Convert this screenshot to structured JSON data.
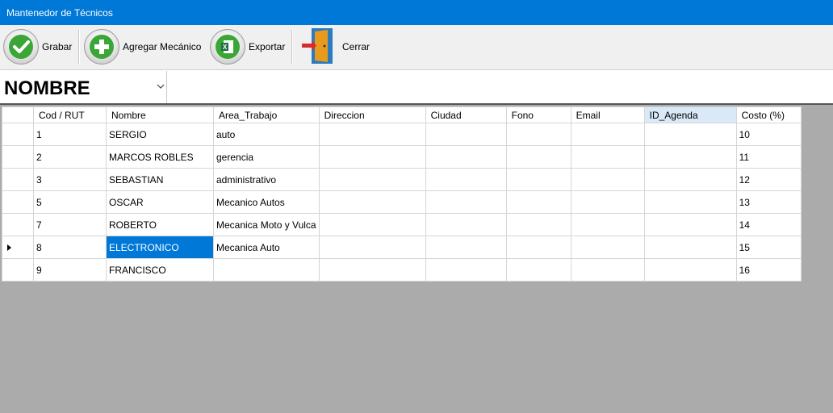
{
  "window": {
    "title": "Mantenedor de Técnicos"
  },
  "toolbar": {
    "grabar": "Grabar",
    "agregar": "Agregar Mecánico",
    "exportar": "Exportar",
    "cerrar": "Cerrar"
  },
  "filter": {
    "selected": "NOMBRE"
  },
  "grid": {
    "headers": [
      "Cod / RUT",
      "Nombre",
      "Area_Trabajo",
      "Direccion",
      "Ciudad",
      "Fono",
      "Email",
      "ID_Agenda",
      "Costo (%)"
    ],
    "rows": [
      [
        "1",
        "SERGIO",
        "auto",
        "",
        "",
        "",
        "",
        "",
        "10"
      ],
      [
        "2",
        "MARCOS ROBLES",
        "gerencia",
        "",
        "",
        "",
        "",
        "",
        "11"
      ],
      [
        "3",
        "SEBASTIAN",
        "administrativo",
        "",
        "",
        "",
        "",
        "",
        "12"
      ],
      [
        "5",
        "OSCAR",
        "Mecanico Autos",
        "",
        "",
        "",
        "",
        "",
        "13"
      ],
      [
        "7",
        "ROBERTO",
        "Mecanica Moto y Vulca",
        "",
        "",
        "",
        "",
        "",
        "14"
      ],
      [
        "8",
        "ELECTRONICO",
        "Mecanica Auto",
        "",
        "",
        "",
        "",
        "",
        "15"
      ],
      [
        "9",
        "FRANCISCO",
        "",
        "",
        "",
        "",
        "",
        "",
        "16"
      ]
    ]
  },
  "icons": {
    "grabar": "checkmark-icon",
    "agregar": "plus-icon",
    "exportar": "excel-icon",
    "cerrar": "door-exit-icon"
  },
  "colors": {
    "titlebar": "#0078d7",
    "selection": "#0078d7",
    "grid_bg": "#ababab"
  }
}
